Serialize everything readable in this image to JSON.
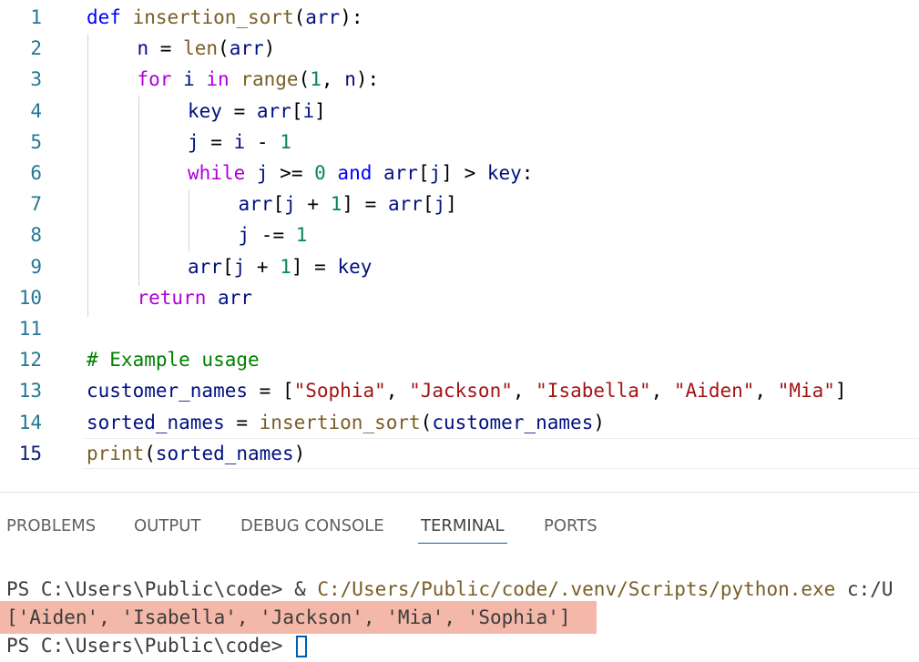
{
  "editor": {
    "active_line": 15,
    "lines": [
      {
        "num": "1",
        "tokens": [
          [
            "def",
            "kw"
          ],
          [
            " ",
            ""
          ],
          [
            "insertion_sort",
            "fn"
          ],
          [
            "(",
            "op"
          ],
          [
            "arr",
            "var"
          ],
          [
            "):",
            "op"
          ]
        ]
      },
      {
        "num": "2",
        "tokens": [
          [
            "n",
            "var"
          ],
          [
            " = ",
            "op"
          ],
          [
            "len",
            "fn"
          ],
          [
            "(",
            "op"
          ],
          [
            "arr",
            "var"
          ],
          [
            ")",
            "op"
          ]
        ]
      },
      {
        "num": "3",
        "tokens": [
          [
            "for",
            "ctl"
          ],
          [
            " ",
            ""
          ],
          [
            "i",
            "var"
          ],
          [
            " ",
            ""
          ],
          [
            "in",
            "ctl"
          ],
          [
            " ",
            ""
          ],
          [
            "range",
            "fn"
          ],
          [
            "(",
            "op"
          ],
          [
            "1",
            "num"
          ],
          [
            ", ",
            "op"
          ],
          [
            "n",
            "var"
          ],
          [
            "):",
            "op"
          ]
        ]
      },
      {
        "num": "4",
        "tokens": [
          [
            "key",
            "var"
          ],
          [
            " = ",
            "op"
          ],
          [
            "arr",
            "var"
          ],
          [
            "[",
            "op"
          ],
          [
            "i",
            "var"
          ],
          [
            "]",
            "op"
          ]
        ]
      },
      {
        "num": "5",
        "tokens": [
          [
            "j",
            "var"
          ],
          [
            " = ",
            "op"
          ],
          [
            "i",
            "var"
          ],
          [
            " - ",
            "op"
          ],
          [
            "1",
            "num"
          ]
        ]
      },
      {
        "num": "6",
        "tokens": [
          [
            "while",
            "ctl"
          ],
          [
            " ",
            ""
          ],
          [
            "j",
            "var"
          ],
          [
            " >= ",
            "op"
          ],
          [
            "0",
            "num"
          ],
          [
            " ",
            ""
          ],
          [
            "and",
            "kw"
          ],
          [
            " ",
            ""
          ],
          [
            "arr",
            "var"
          ],
          [
            "[",
            "op"
          ],
          [
            "j",
            "var"
          ],
          [
            "]",
            "op"
          ],
          [
            " > ",
            "op"
          ],
          [
            "key",
            "var"
          ],
          [
            ":",
            "op"
          ]
        ]
      },
      {
        "num": "7",
        "tokens": [
          [
            "arr",
            "var"
          ],
          [
            "[",
            "op"
          ],
          [
            "j",
            "var"
          ],
          [
            " + ",
            "op"
          ],
          [
            "1",
            "num"
          ],
          [
            "]",
            "op"
          ],
          [
            " = ",
            "op"
          ],
          [
            "arr",
            "var"
          ],
          [
            "[",
            "op"
          ],
          [
            "j",
            "var"
          ],
          [
            "]",
            "op"
          ]
        ]
      },
      {
        "num": "8",
        "tokens": [
          [
            "j",
            "var"
          ],
          [
            " -= ",
            "op"
          ],
          [
            "1",
            "num"
          ]
        ]
      },
      {
        "num": "9",
        "tokens": [
          [
            "arr",
            "var"
          ],
          [
            "[",
            "op"
          ],
          [
            "j",
            "var"
          ],
          [
            " + ",
            "op"
          ],
          [
            "1",
            "num"
          ],
          [
            "]",
            "op"
          ],
          [
            " = ",
            "op"
          ],
          [
            "key",
            "var"
          ]
        ]
      },
      {
        "num": "10",
        "tokens": [
          [
            "return",
            "ctl"
          ],
          [
            " ",
            ""
          ],
          [
            "arr",
            "var"
          ]
        ]
      },
      {
        "num": "11",
        "tokens": []
      },
      {
        "num": "12",
        "tokens": [
          [
            "# Example usage",
            "cmt"
          ]
        ]
      },
      {
        "num": "13",
        "tokens": [
          [
            "customer_names",
            "var"
          ],
          [
            " = ",
            "op"
          ],
          [
            "[",
            "op"
          ],
          [
            "\"Sophia\"",
            "str"
          ],
          [
            ", ",
            "op"
          ],
          [
            "\"Jackson\"",
            "str"
          ],
          [
            ", ",
            "op"
          ],
          [
            "\"Isabella\"",
            "str"
          ],
          [
            ", ",
            "op"
          ],
          [
            "\"Aiden\"",
            "str"
          ],
          [
            ", ",
            "op"
          ],
          [
            "\"Mia\"",
            "str"
          ],
          [
            "]",
            "op"
          ]
        ]
      },
      {
        "num": "14",
        "tokens": [
          [
            "sorted_names",
            "var"
          ],
          [
            " = ",
            "op"
          ],
          [
            "insertion_sort",
            "fn"
          ],
          [
            "(",
            "op"
          ],
          [
            "customer_names",
            "var"
          ],
          [
            ")",
            "op"
          ]
        ]
      },
      {
        "num": "15",
        "tokens": [
          [
            "print",
            "fn"
          ],
          [
            "(",
            "op"
          ],
          [
            "sorted_names",
            "var"
          ],
          [
            ")",
            "op"
          ]
        ]
      }
    ]
  },
  "panel": {
    "tabs": [
      {
        "label": "PROBLEMS",
        "active": false
      },
      {
        "label": "OUTPUT",
        "active": false
      },
      {
        "label": "DEBUG CONSOLE",
        "active": false
      },
      {
        "label": "TERMINAL",
        "active": true
      },
      {
        "label": "PORTS",
        "active": false
      }
    ],
    "terminal": {
      "prompt1": "PS C:\\Users\\Public\\code> ",
      "command_amp": "& ",
      "command_exe": "C:/Users/Public/code/.venv/Scripts/python.exe",
      "command_arg": " c:/U",
      "output": "['Aiden', 'Isabella', 'Jackson', 'Mia', 'Sophia']",
      "prompt2": "PS C:\\Users\\Public\\code> "
    }
  },
  "colors": {
    "highlight": "#f4b8a8",
    "accent": "#005fb8"
  }
}
